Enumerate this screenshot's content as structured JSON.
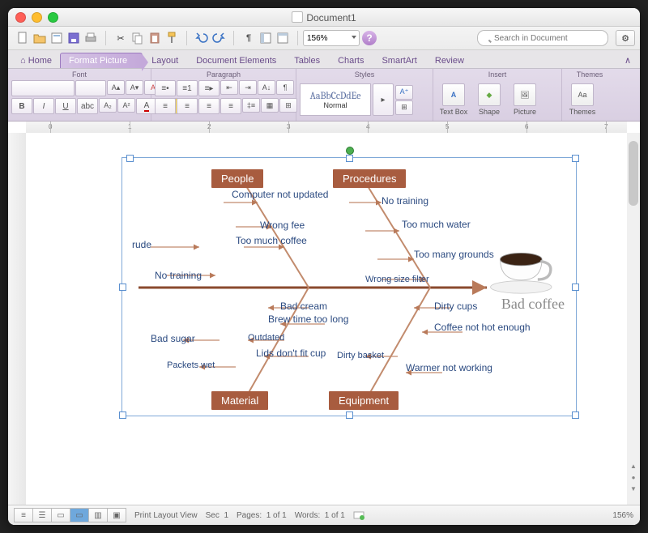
{
  "window": {
    "title": "Document1"
  },
  "quickbar": {
    "zoom": "156%",
    "search_placeholder": "Search in Document"
  },
  "tabs": [
    "Home",
    "Format Picture",
    "Layout",
    "Document Elements",
    "Tables",
    "Charts",
    "SmartArt",
    "Review"
  ],
  "ribbon": {
    "groups": {
      "font": "Font",
      "paragraph": "Paragraph",
      "styles": "Styles",
      "insert": "Insert",
      "themes": "Themes"
    },
    "style_preview": "AaBbCcDdEe",
    "style_name": "Normal",
    "insert_items": {
      "textbox": "Text Box",
      "shape": "Shape",
      "picture": "Picture"
    },
    "themes_btn": "Themes"
  },
  "fishbone": {
    "effect": "Bad coffee",
    "categories": {
      "people": "People",
      "procedures": "Procedures",
      "material": "Material",
      "equipment": "Equipment"
    },
    "causes": {
      "people": [
        "Computer not updated",
        "Wrong fee",
        "Too much coffee",
        "rude",
        "No training"
      ],
      "procedures": [
        "No training",
        "Too much water",
        "Too many grounds",
        "Wrong size filter"
      ],
      "material": [
        "Bad cream",
        "Brew time too long",
        "Outdated",
        "Lids don't fit cup",
        "Bad sugar",
        "Packets wet"
      ],
      "equipment": [
        "Dirty cups",
        "Coffee not hot enough",
        "Dirty basket",
        "Warmer not working"
      ]
    }
  },
  "status": {
    "view": "Print Layout View",
    "sec_label": "Sec",
    "sec": "1",
    "pages_label": "Pages:",
    "pages": "1 of 1",
    "words_label": "Words:",
    "words": "1 of 1",
    "zoom": "156%"
  }
}
